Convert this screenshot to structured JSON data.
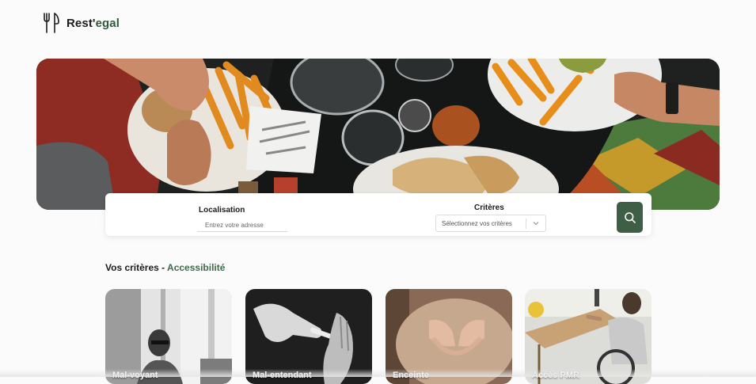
{
  "brand": {
    "name_main": "Rest'",
    "name_accent": "egal",
    "icon": "fork-knife-icon",
    "accent_color": "#2f5a3b"
  },
  "search": {
    "location_label": "Localisation",
    "location_placeholder": "Entrez votre adresse",
    "criteria_label": "Critères",
    "criteria_placeholder": "Sélectionnez vos critères",
    "button_icon": "search-icon",
    "button_color": "#3e5f45"
  },
  "section": {
    "title_prefix": "Vos critères - ",
    "title_accent": "Accessibilité"
  },
  "categories": [
    {
      "label": "Mal-voyant"
    },
    {
      "label": "Mal-entendant"
    },
    {
      "label": "Enceinte"
    },
    {
      "label": "Accès PMR"
    }
  ]
}
